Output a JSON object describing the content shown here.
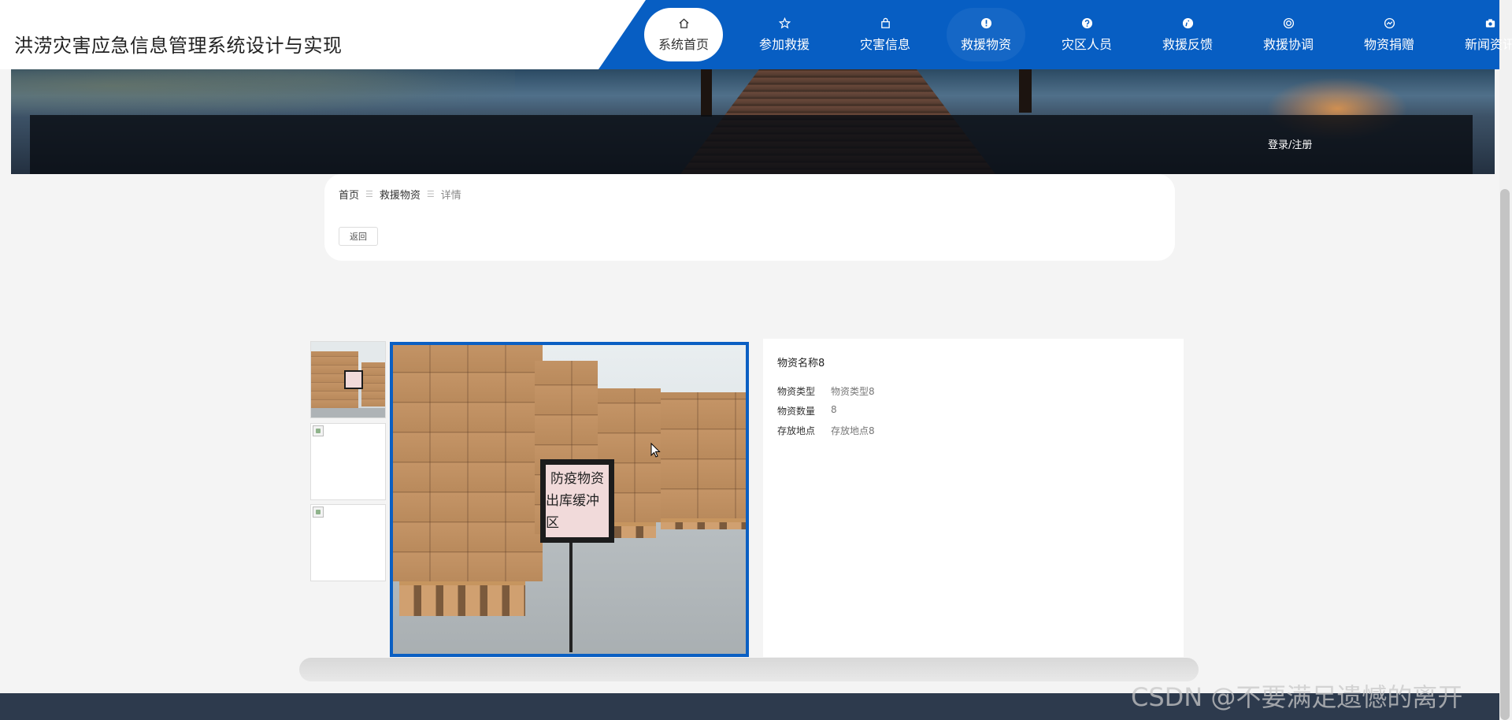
{
  "site": {
    "title": "洪涝灾害应急信息管理系统设计与实现"
  },
  "nav": {
    "items": [
      {
        "label": "系统首页",
        "icon": "home-icon",
        "active": true
      },
      {
        "label": "参加救援",
        "icon": "star-icon"
      },
      {
        "label": "灾害信息",
        "icon": "bag-icon"
      },
      {
        "label": "救援物资",
        "icon": "alert-icon"
      },
      {
        "label": "灾区人员",
        "icon": "question-icon"
      },
      {
        "label": "救援反馈",
        "icon": "info-icon"
      },
      {
        "label": "救援协调",
        "icon": "lifebuoy-icon"
      },
      {
        "label": "物资捐赠",
        "icon": "chart-circle-icon"
      },
      {
        "label": "新闻资讯",
        "icon": "camera-icon"
      }
    ]
  },
  "header": {
    "login_label": "登录/注册"
  },
  "breadcrumb": {
    "home": "首页",
    "middle": "救援物资",
    "current": "详情",
    "separator": "☰"
  },
  "toolbar": {
    "back_label": "返回"
  },
  "sign": {
    "line1": "防疫物资",
    "line2": "出库缓冲区"
  },
  "detail": {
    "title": "物资名称8",
    "rows": [
      {
        "label": "物资类型",
        "value": "物资类型8"
      },
      {
        "label": "物资数量",
        "value": "8"
      },
      {
        "label": "存放地点",
        "value": "存放地点8"
      }
    ]
  },
  "watermark": "CSDN @不要满足遗憾的离开",
  "colors": {
    "nav_blue": "#075ec3",
    "footer": "#2d3a4d",
    "page_bg": "#f4f4f4"
  }
}
